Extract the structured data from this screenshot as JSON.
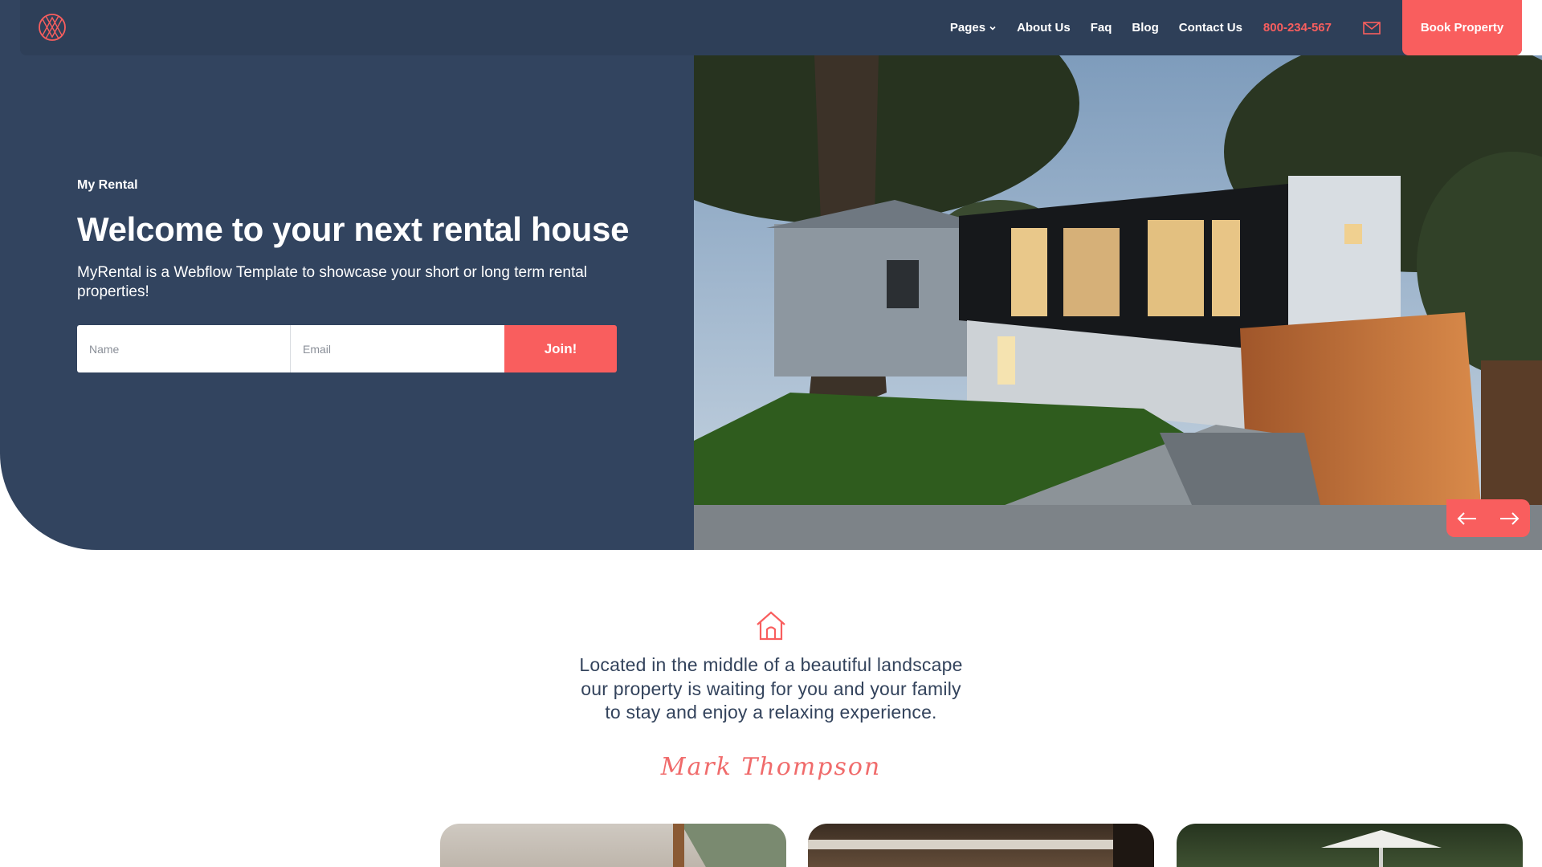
{
  "brand": {
    "accent": "#f95e5e",
    "navy": "#32445f"
  },
  "nav": {
    "logo_icon": "lattice-logo-icon",
    "links": [
      {
        "label": "Pages",
        "has_dropdown": true
      },
      {
        "label": "About Us"
      },
      {
        "label": "Faq"
      },
      {
        "label": "Blog"
      },
      {
        "label": "Contact Us"
      }
    ],
    "phone": "800-234-567",
    "mail_icon": "mail-icon",
    "book_button": "Book Property"
  },
  "hero": {
    "eyebrow": "My Rental",
    "title": "Welcome to your next rental house",
    "subtitle": "MyRental is a Webflow Template to showcase your short or long term rental properties!",
    "form": {
      "name_placeholder": "Name",
      "email_placeholder": "Email",
      "submit_label": "Join!"
    },
    "slider": {
      "prev_icon": "arrow-left-icon",
      "next_icon": "arrow-right-icon"
    }
  },
  "intro": {
    "icon": "house-icon",
    "text": "Located in the middle of a beautiful landscape our property is waiting for you and your family to stay and enjoy a relaxing experience.",
    "signature": "Mark Thompson"
  }
}
